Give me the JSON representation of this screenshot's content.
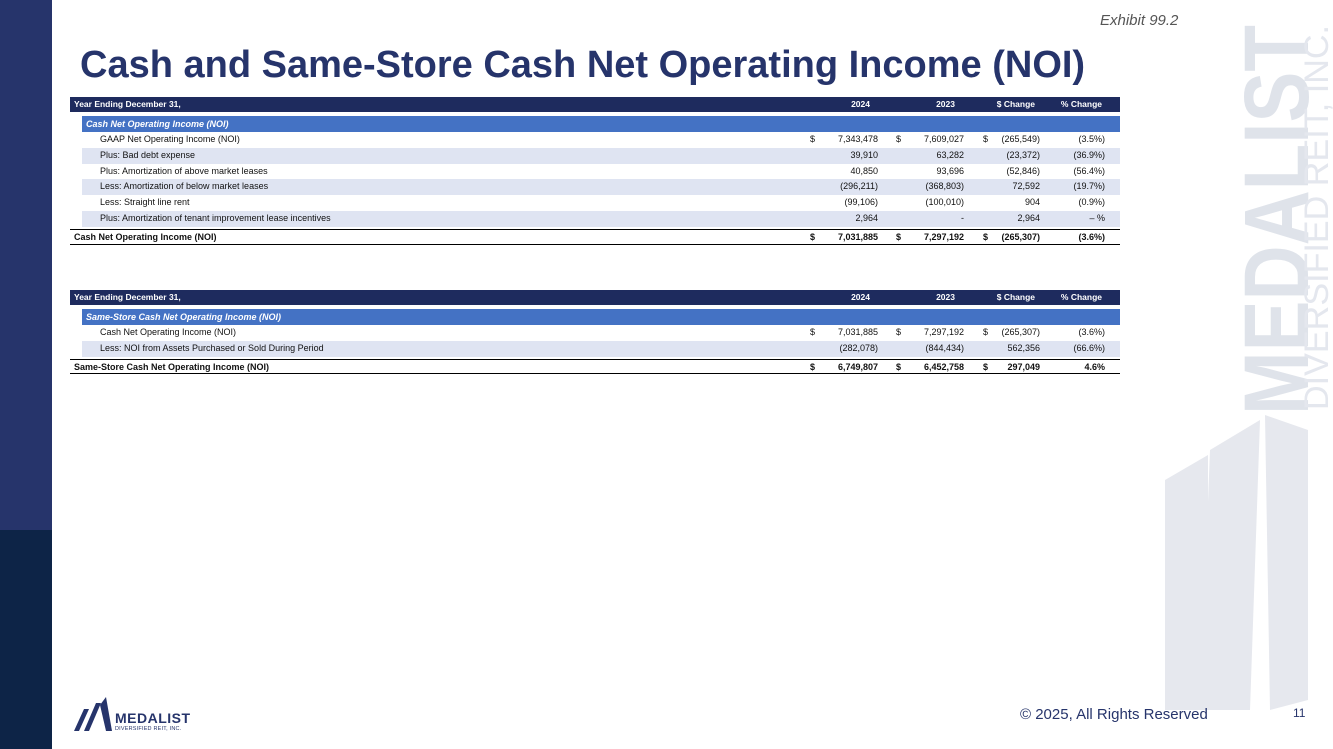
{
  "exhibit": "Exhibit 99.2",
  "title": "Cash and Same-Store Cash Net Operating Income (NOI)",
  "table1": {
    "header": {
      "label": "Year Ending December 31,",
      "y2024": "2024",
      "y2023": "2023",
      "chg": "$ Change",
      "pct": "% Change"
    },
    "section": "Cash Net Operating Income (NOI)",
    "rows": [
      {
        "label": "GAAP Net Operating Income (NOI)",
        "d1": "$",
        "v2024": "7,343,478",
        "d2": "$",
        "v2023": "7,609,027",
        "d3": "$",
        "chg": "(265,549)",
        "pct": "(3.5%)"
      },
      {
        "label": "Plus:  Bad debt expense",
        "d1": "",
        "v2024": "39,910",
        "d2": "",
        "v2023": "63,282",
        "d3": "",
        "chg": "(23,372)",
        "pct": "(36.9%)"
      },
      {
        "label": "Plus:  Amortization of above market leases",
        "d1": "",
        "v2024": "40,850",
        "d2": "",
        "v2023": "93,696",
        "d3": "",
        "chg": "(52,846)",
        "pct": "(56.4%)"
      },
      {
        "label": "Less:  Amortization of below market leases",
        "d1": "",
        "v2024": "(296,211)",
        "d2": "",
        "v2023": "(368,803)",
        "d3": "",
        "chg": "72,592",
        "pct": "(19.7%)"
      },
      {
        "label": "Less:  Straight line rent",
        "d1": "",
        "v2024": "(99,106)",
        "d2": "",
        "v2023": "(100,010)",
        "d3": "",
        "chg": "904",
        "pct": "(0.9%)"
      },
      {
        "label": "Plus:  Amortization of tenant improvement lease incentives",
        "d1": "",
        "v2024": "2,964",
        "d2": "",
        "v2023": "-",
        "d3": "",
        "chg": "2,964",
        "pct": "– %"
      }
    ],
    "total": {
      "label": "Cash Net Operating Income (NOI)",
      "d1": "$",
      "v2024": "7,031,885",
      "d2": "$",
      "v2023": "7,297,192",
      "d3": "$",
      "chg": "(265,307)",
      "pct": "(3.6%)"
    }
  },
  "table2": {
    "header": {
      "label": "Year Ending December 31,",
      "y2024": "2024",
      "y2023": "2023",
      "chg": "$ Change",
      "pct": "% Change"
    },
    "section": "Same-Store Cash Net Operating Income (NOI)",
    "rows": [
      {
        "label": "Cash Net Operating Income (NOI)",
        "d1": "$",
        "v2024": "7,031,885",
        "d2": "$",
        "v2023": "7,297,192",
        "d3": "$",
        "chg": "(265,307)",
        "pct": "(3.6%)"
      },
      {
        "label": "Less:  NOI from Assets Purchased or Sold During Period",
        "d1": "",
        "v2024": "(282,078)",
        "d2": "",
        "v2023": "(844,434)",
        "d3": "",
        "chg": "562,356",
        "pct": "(66.6%)"
      }
    ],
    "total": {
      "label": "Same-Store Cash Net Operating Income (NOI)",
      "d1": "$",
      "v2024": "6,749,807",
      "d2": "$",
      "v2023": "6,452,758",
      "d3": "$",
      "chg": "297,049",
      "pct": "4.6%"
    }
  },
  "footer": {
    "copyright": "© 2025, All Rights Reserved",
    "page": "11",
    "logo_name": "MEDALIST",
    "logo_sub": "DIVERSIFIED REIT, INC."
  },
  "watermark": {
    "line1": "MEDALIST",
    "line2": "DIVERSIFIED REIT, INC."
  },
  "colors": {
    "navy": "#26346b",
    "header": "#1e2b5e",
    "section": "#4472c4",
    "alt_row": "#dfe4f2",
    "dark_bar": "#0d2447"
  }
}
